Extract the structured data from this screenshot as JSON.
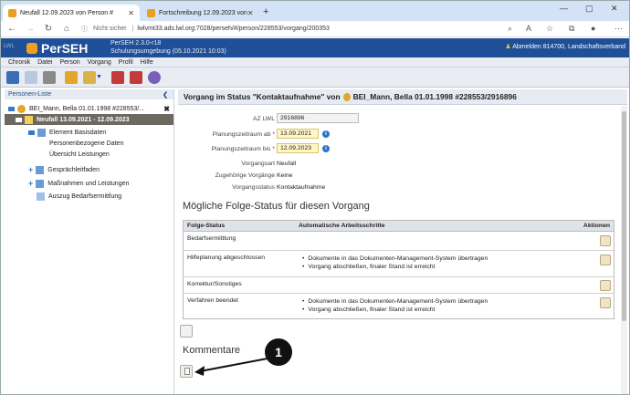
{
  "browser": {
    "tabs": [
      {
        "title": "Neufall 12.09.2023 von Person #",
        "active": true
      },
      {
        "title": "Fortschreibung 12.09.2023 von",
        "active": false
      }
    ],
    "new_tab": "+",
    "security": "Nicht sicher",
    "url": "lwlvmt33.ads.lwl.org:7028/perseh/#/person/228553/vorgang/200353"
  },
  "app": {
    "name": "PerSEH",
    "version": "PerSEH 2.3.0-r18",
    "environment": "Schulungsumgebung (05.10.2021 10:03)",
    "logout": "Abmelden 814700, Landschaftsverband",
    "menu": [
      "Chronik",
      "Datei",
      "Person",
      "Vorgang",
      "Profil",
      "Hilfe"
    ]
  },
  "left": {
    "title": "Personen-Liste",
    "tree": [
      {
        "label": "BEI_Mann, Bella 01.01.1998 #228553/...",
        "indent": 0,
        "kind": "person"
      },
      {
        "label": "Neufall 13.09.2021 - 12.09.2023",
        "indent": 1,
        "kind": "selected"
      },
      {
        "label": "Element Basisdaten",
        "indent": 2,
        "kind": "folder-open"
      },
      {
        "label": "Personenbezogene Daten",
        "indent": 3,
        "kind": "text"
      },
      {
        "label": "Übersicht Leistungen",
        "indent": 3,
        "kind": "text"
      },
      {
        "label": "Gesprächleitfaden",
        "indent": 2,
        "kind": "folder-closed"
      },
      {
        "label": "Maßnahmen und Leistungen",
        "indent": 2,
        "kind": "folder-closed"
      },
      {
        "label": "Auszug Bedarfsermittlung",
        "indent": 2,
        "kind": "doc"
      }
    ]
  },
  "main": {
    "title": "Vorgang im Status \"Kontaktaufnahme\" von",
    "title_person": "BEI_Mann, Bella 01.01.1998 #228553/2916896",
    "fields": {
      "az_label": "AZ LWL",
      "az_value": "2916896",
      "plan_ab_label": "Planungszeitraum ab",
      "plan_ab_value": "13.09.2021",
      "plan_bis_label": "Planungszeitraum bis",
      "plan_bis_value": "12.09.2023",
      "vorgangsart_label": "Vorgangsart",
      "vorgangsart_value": "Neufall",
      "zugehoerig_label": "Zugehörige Vorgänge",
      "zugehoerig_value": "Keine",
      "status_label": "Vorgangsstatus",
      "status_value": "Kontaktaufnahme"
    },
    "folge_title": "Mögliche Folge-Status für diesen Vorgang",
    "table": {
      "headers": [
        "Folge-Status",
        "Automatische Arbeitsschritte",
        "Aktionen"
      ],
      "rows": [
        {
          "status": "Bedarfsermittlung",
          "steps": []
        },
        {
          "status": "Hilfeplanung abgeschlossen",
          "steps": [
            "Dokumente in das Dokumenten-Management-System übertragen",
            "Vorgang abschließen, finaler Stand ist erreicht"
          ]
        },
        {
          "status": "Korrektur/Sonstiges",
          "steps": []
        },
        {
          "status": "Verfahren beendet",
          "steps": [
            "Dokumente in das Dokumenten-Management-System übertragen",
            "Vorgang abschließen, finaler Stand ist erreicht"
          ]
        }
      ]
    },
    "kommentare_title": "Kommentare"
  },
  "annotation": {
    "callout": "1"
  }
}
